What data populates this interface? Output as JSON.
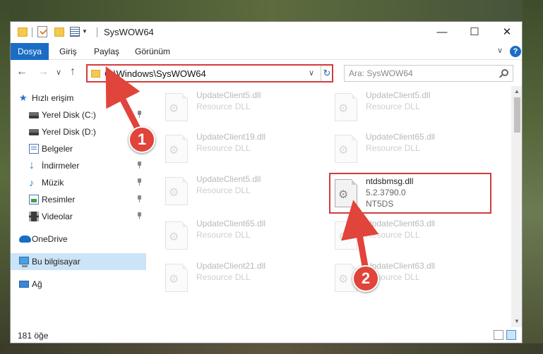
{
  "window": {
    "title": "SysWOW64",
    "minimize_glyph": "—",
    "maximize_glyph": "☐",
    "close_glyph": "✕"
  },
  "ribbon": {
    "tabs": [
      "Dosya",
      "Giriş",
      "Paylaş",
      "Görünüm"
    ],
    "chevron": "∨",
    "help": "?"
  },
  "nav": {
    "back": "←",
    "forward": "→",
    "recent": "∨",
    "up": "↑",
    "address": "C:\\Windows\\SysWOW64",
    "address_dropdown": "∨",
    "refresh": "↻",
    "search_placeholder": "Ara: SysWOW64"
  },
  "sidebar": {
    "items": [
      {
        "label": "Hızlı erişim",
        "icon": "star-icon"
      },
      {
        "label": "Yerel Disk (C:)",
        "icon": "drive-icon"
      },
      {
        "label": "Yerel Disk (D:)",
        "icon": "drive-icon"
      },
      {
        "label": "Belgeler",
        "icon": "documents-icon"
      },
      {
        "label": "İndirmeler",
        "icon": "download-icon"
      },
      {
        "label": "Müzik",
        "icon": "music-icon"
      },
      {
        "label": "Resimler",
        "icon": "pictures-icon"
      },
      {
        "label": "Videolar",
        "icon": "videos-icon"
      },
      {
        "label": "OneDrive",
        "icon": "cloud-icon"
      },
      {
        "label": "Bu bilgisayar",
        "icon": "computer-icon"
      },
      {
        "label": "Ağ",
        "icon": "network-icon"
      }
    ]
  },
  "files": [
    {
      "name": "UpdateClient5.dll",
      "type": "Resource DLL"
    },
    {
      "name": "UpdateClient5.dll",
      "type": "Resource DLL"
    },
    {
      "name": "UpdateClient19.dll",
      "type": "Resource DLL"
    },
    {
      "name": "UpdateClient65.dll",
      "type": "Resource DLL"
    },
    {
      "name": "UpdateClient5.dll",
      "type": "Resource DLL"
    },
    {
      "name": "ntdsbmsg.dll",
      "version": "5.2.3790.0",
      "type": "NT5DS"
    },
    {
      "name": "UpdateClient65.dll",
      "type": "Resource DLL"
    },
    {
      "name": "UpdateClient63.dll",
      "type": "Resource DLL"
    },
    {
      "name": "UpdateClient21.dll",
      "type": "Resource DLL"
    },
    {
      "name": "UpdateClient63.dll",
      "type": "Resource DLL"
    }
  ],
  "status": {
    "count": "181 öğe"
  },
  "annotations": {
    "step1": "1",
    "step2": "2",
    "color": "#e1443b"
  },
  "colors": {
    "accent": "#1a6dc5",
    "highlight_border": "#d43b3b",
    "selected_bg": "#cce4f7"
  }
}
